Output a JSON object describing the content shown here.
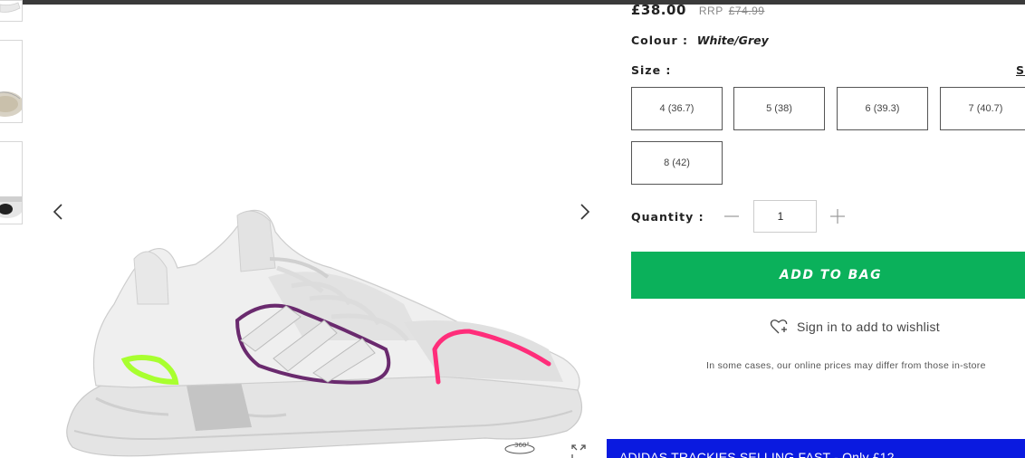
{
  "product": {
    "price": "£38.00",
    "rrp_label": "RRP",
    "rrp_price": "£74.99",
    "colour_label": "Colour :",
    "colour_value": "White/Grey",
    "size_label": "Size :",
    "size_guide": "Size Guide",
    "sizes": [
      "4 (36.7)",
      "5 (38)",
      "6 (39.3)",
      "7 (40.7)",
      "8 (42)"
    ],
    "quantity_label": "Quantity :",
    "quantity_value": "1",
    "add_to_bag": "ADD TO BAG",
    "wishlist": "Sign in to add to wishlist",
    "disclaimer": "In some cases, our online prices may differ from those in-store"
  },
  "gallery": {
    "view360_label": "360°"
  },
  "promo": {
    "text": "ADIDAS TRACKIES SELLING FAST - Only £12"
  },
  "colors": {
    "accent_green": "#0bb15b",
    "promo_blue": "#0a1ae0"
  },
  "icons": [
    "chevron-left-icon",
    "chevron-right-icon",
    "view-360-icon",
    "expand-icon",
    "minus-icon",
    "plus-icon",
    "heart-plus-icon"
  ]
}
